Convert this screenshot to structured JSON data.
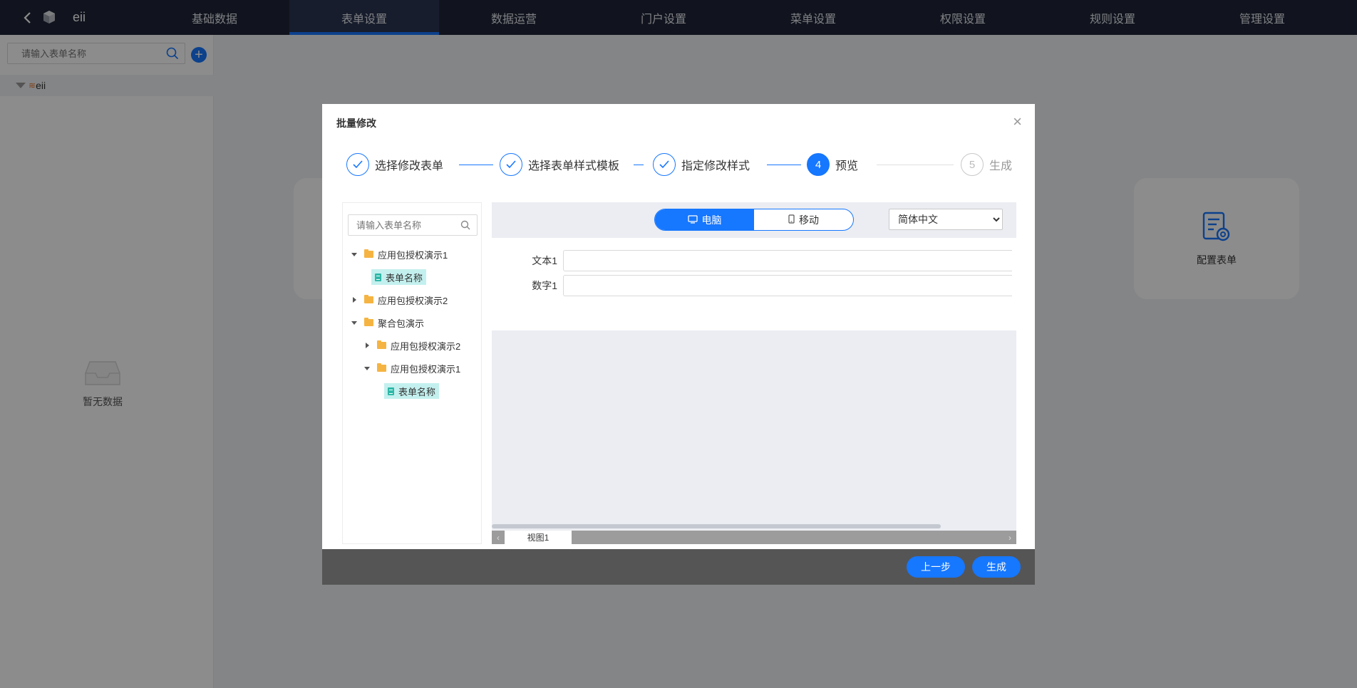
{
  "app": {
    "name": "eii"
  },
  "nav": {
    "tabs": [
      {
        "label": "基础数据"
      },
      {
        "label": "表单设置",
        "active": true
      },
      {
        "label": "数据运营"
      },
      {
        "label": "门户设置"
      },
      {
        "label": "菜单设置"
      },
      {
        "label": "权限设置"
      },
      {
        "label": "规则设置"
      },
      {
        "label": "管理设置"
      }
    ]
  },
  "sidebar": {
    "search_placeholder": "请输入表单名称",
    "tree_root": "eii",
    "empty_text": "暂无数据"
  },
  "workspace": {
    "config_card_label": "配置表单"
  },
  "modal": {
    "title": "批量修改",
    "steps": [
      {
        "index": "1",
        "label": "选择修改表单",
        "status": "done"
      },
      {
        "index": "2",
        "label": "选择表单样式模板",
        "status": "done"
      },
      {
        "index": "3",
        "label": "指定修改样式",
        "status": "done"
      },
      {
        "index": "4",
        "label": "预览",
        "status": "current"
      },
      {
        "index": "5",
        "label": "生成",
        "status": "todo"
      }
    ],
    "tree": {
      "search_placeholder": "请输入表单名称",
      "nodes": [
        {
          "label": "应用包授权演示1",
          "type": "folder",
          "expanded": true
        },
        {
          "label": "表单名称",
          "type": "form",
          "selected": true
        },
        {
          "label": "应用包授权演示2",
          "type": "folder",
          "expanded": false
        },
        {
          "label": "聚合包演示",
          "type": "folder",
          "expanded": true
        },
        {
          "label": "应用包授权演示2",
          "type": "folder",
          "expanded": false
        },
        {
          "label": "应用包授权演示1",
          "type": "folder",
          "expanded": true
        },
        {
          "label": "表单名称",
          "type": "form",
          "selected": true
        }
      ]
    },
    "preview": {
      "device_desktop": "电脑",
      "device_mobile": "移动",
      "active_device": "desktop",
      "language": "简体中文",
      "fields": [
        {
          "label": "文本1",
          "value": ""
        },
        {
          "label": "数字1",
          "value": ""
        }
      ],
      "sheet_tab": "视图1"
    },
    "buttons": {
      "prev": "上一步",
      "generate": "生成"
    }
  },
  "colors": {
    "primary": "#1677ff",
    "topbar": "#1f2537",
    "footer": "#555555"
  }
}
